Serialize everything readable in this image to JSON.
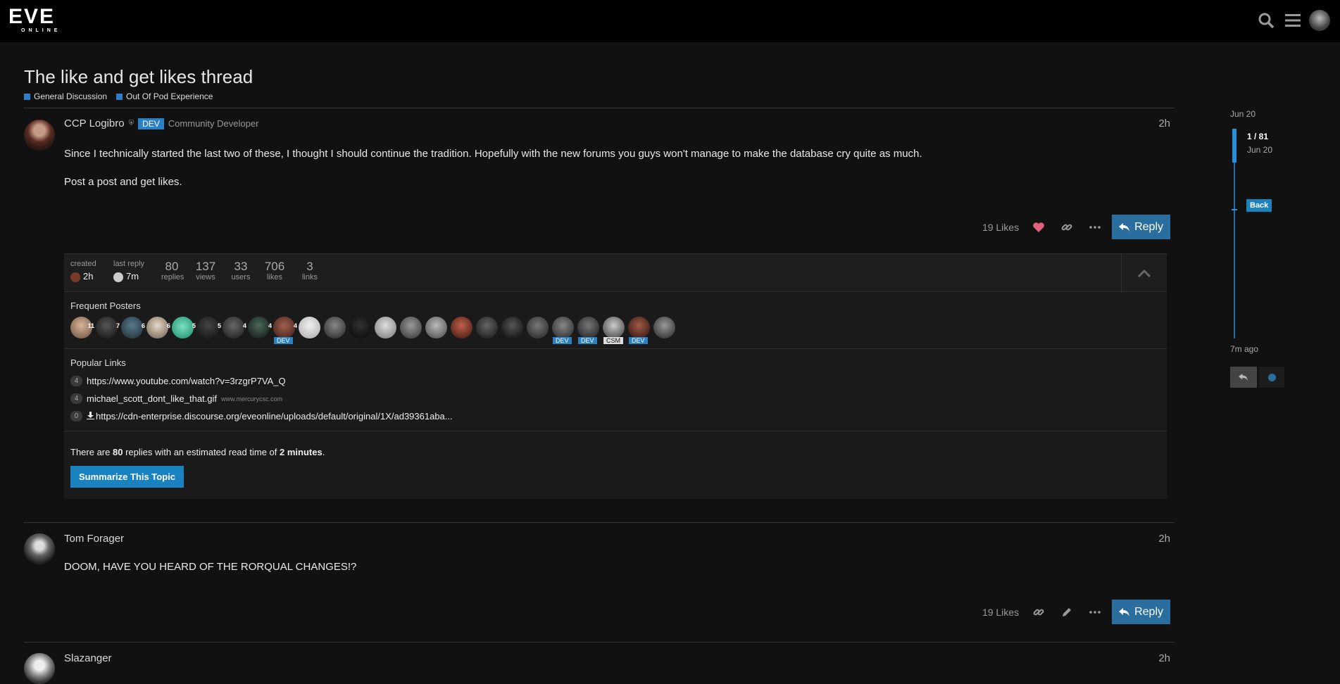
{
  "header": {
    "logo_big": "EVE",
    "logo_small": "ONLINE"
  },
  "topic": {
    "title": "The like and get likes thread",
    "categories": [
      "General Discussion",
      "Out Of Pod Experience"
    ]
  },
  "posts": [
    {
      "author": "CCP Logibro",
      "flair": "DEV",
      "user_title": "Community Developer",
      "time": "2h",
      "body": [
        "Since I technically started the last two of these, I thought I should continue the tradition. Hopefully with the new forums you guys won't manage to make the database cry quite as much.",
        "Post a post and get likes."
      ],
      "likes": "19 Likes",
      "reply_label": "Reply"
    },
    {
      "author": "Tom Forager",
      "time": "2h",
      "body": [
        "DOOM, HAVE YOU HEARD OF THE RORQUAL CHANGES!?"
      ],
      "likes": "19 Likes",
      "reply_label": "Reply"
    },
    {
      "author": "Slazanger",
      "time": "2h"
    }
  ],
  "topic_map": {
    "created_label": "created",
    "created_time": "2h",
    "last_reply_label": "last reply",
    "last_reply_time": "7m",
    "stats": [
      {
        "num": "80",
        "label": "replies"
      },
      {
        "num": "137",
        "label": "views"
      },
      {
        "num": "33",
        "label": "users"
      },
      {
        "num": "706",
        "label": "likes"
      },
      {
        "num": "3",
        "label": "links"
      }
    ],
    "frequent_posters_title": "Frequent Posters",
    "poster_counts": [
      "11",
      "7",
      "6",
      "6",
      "5",
      "5",
      "4",
      "4",
      "4"
    ],
    "poster_flairs": [
      "DEV",
      "DEV",
      "DEV",
      "CSM",
      "DEV"
    ],
    "popular_links_title": "Popular Links",
    "links": [
      {
        "count": "4",
        "text": "https://www.youtube.com/watch?v=3rzgrP7VA_Q",
        "domain": ""
      },
      {
        "count": "4",
        "text": "michael_scott_dont_like_that.gif",
        "domain": "www.mercurycsc.com"
      },
      {
        "count": "0",
        "text": "https://cdn-enterprise.discourse.org/eveonline/uploads/default/original/1X/ad39361aba...",
        "domain": ""
      }
    ],
    "summary_pre": "There are ",
    "summary_replies": "80",
    "summary_mid": " replies with an estimated read time of ",
    "summary_time": "2 minutes",
    "summary_post": ".",
    "summarize_button": "Summarize This Topic"
  },
  "timeline": {
    "start_date": "Jun 20",
    "position": "1 / 81",
    "position_date": "Jun 20",
    "back_label": "Back",
    "end_label": "7m ago"
  },
  "colors": {
    "accent": "#2a7fc5",
    "reply_button": "#2a6ea0",
    "background": "#111111",
    "heart": "#e0607e"
  }
}
